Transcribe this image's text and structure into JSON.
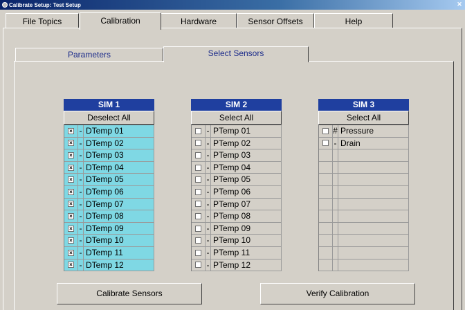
{
  "window": {
    "title": "Calibrate Setup: Test Setup",
    "close_label": "✕"
  },
  "main_tabs": [
    {
      "label": "File Topics"
    },
    {
      "label": "Calibration"
    },
    {
      "label": "Hardware"
    },
    {
      "label": "Sensor Offsets"
    },
    {
      "label": "Help"
    }
  ],
  "sub_tabs": [
    {
      "label": "Parameters"
    },
    {
      "label": "Select Sensors"
    }
  ],
  "sims": [
    {
      "title": "SIM 1",
      "button": "Deselect All",
      "rows": [
        {
          "mark": "-",
          "name": "DTemp 01",
          "checked": true
        },
        {
          "mark": "-",
          "name": "DTemp 02",
          "checked": true
        },
        {
          "mark": "-",
          "name": "DTemp 03",
          "checked": true
        },
        {
          "mark": "-",
          "name": "DTemp 04",
          "checked": true
        },
        {
          "mark": "-",
          "name": "DTemp 05",
          "checked": true
        },
        {
          "mark": "-",
          "name": "DTemp 06",
          "checked": true
        },
        {
          "mark": "-",
          "name": "DTemp 07",
          "checked": true
        },
        {
          "mark": "-",
          "name": "DTemp 08",
          "checked": true
        },
        {
          "mark": "-",
          "name": "DTemp 09",
          "checked": true
        },
        {
          "mark": "-",
          "name": "DTemp 10",
          "checked": true
        },
        {
          "mark": "-",
          "name": "DTemp 11",
          "checked": true
        },
        {
          "mark": "-",
          "name": "DTemp 12",
          "checked": true
        }
      ]
    },
    {
      "title": "SIM 2",
      "button": "Select All",
      "rows": [
        {
          "mark": "-",
          "name": "PTemp 01",
          "checked": false
        },
        {
          "mark": "-",
          "name": "PTemp 02",
          "checked": false
        },
        {
          "mark": "-",
          "name": "PTemp 03",
          "checked": false
        },
        {
          "mark": "-",
          "name": "PTemp 04",
          "checked": false
        },
        {
          "mark": "-",
          "name": "PTemp 05",
          "checked": false
        },
        {
          "mark": "-",
          "name": "PTemp 06",
          "checked": false
        },
        {
          "mark": "-",
          "name": "PTemp 07",
          "checked": false
        },
        {
          "mark": "-",
          "name": "PTemp 08",
          "checked": false
        },
        {
          "mark": "-",
          "name": "PTemp 09",
          "checked": false
        },
        {
          "mark": "-",
          "name": "PTemp 10",
          "checked": false
        },
        {
          "mark": "-",
          "name": "PTemp 11",
          "checked": false
        },
        {
          "mark": "-",
          "name": "PTemp 12",
          "checked": false
        }
      ]
    },
    {
      "title": "SIM 3",
      "button": "Select All",
      "rows": [
        {
          "mark": "#",
          "name": "Pressure",
          "checked": false,
          "has_box": true
        },
        {
          "mark": "-",
          "name": "Drain",
          "checked": false,
          "has_box": true
        },
        {
          "mark": "",
          "name": "",
          "has_box": false
        },
        {
          "mark": "",
          "name": "",
          "has_box": false
        },
        {
          "mark": "",
          "name": "",
          "has_box": false
        },
        {
          "mark": "",
          "name": "",
          "has_box": false
        },
        {
          "mark": "",
          "name": "",
          "has_box": false
        },
        {
          "mark": "",
          "name": "",
          "has_box": false
        },
        {
          "mark": "",
          "name": "",
          "has_box": false
        },
        {
          "mark": "",
          "name": "",
          "has_box": false
        },
        {
          "mark": "",
          "name": "",
          "has_box": false
        },
        {
          "mark": "",
          "name": "",
          "has_box": false
        }
      ]
    }
  ],
  "actions": {
    "calibrate": "Calibrate Sensors",
    "verify": "Verify Calibration"
  },
  "colors": {
    "sim_header": "#1f3f9f",
    "selected_row": "#7fd8e4",
    "window_bg": "#d4d0c8"
  }
}
